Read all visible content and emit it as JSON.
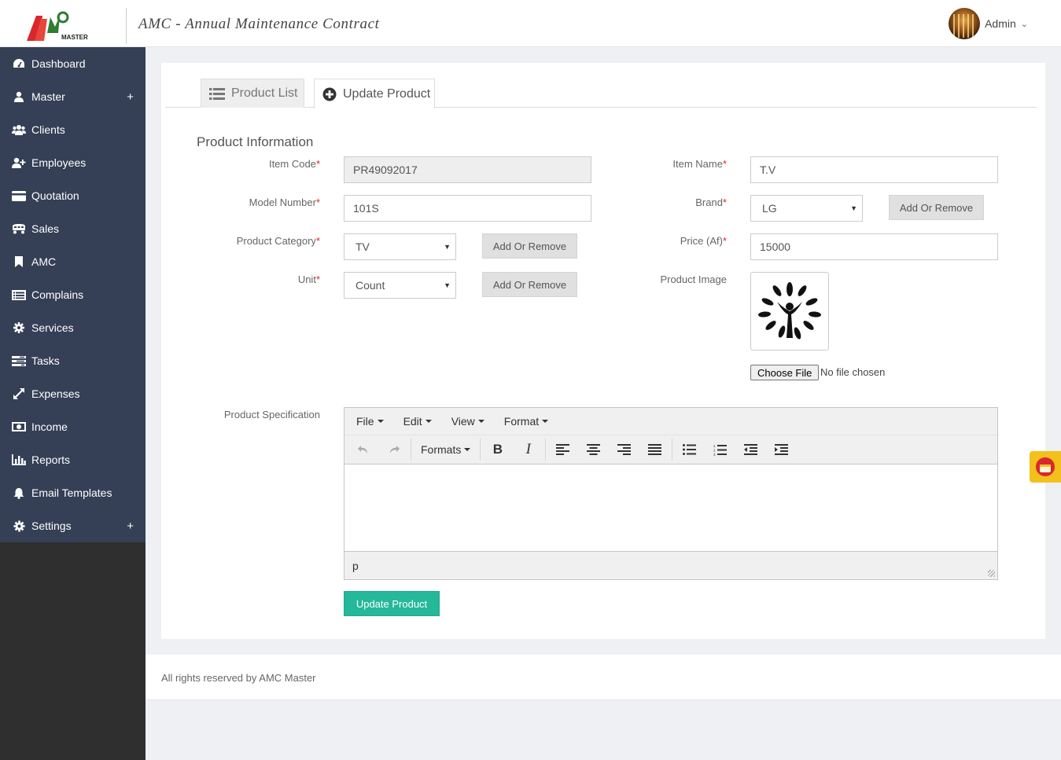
{
  "header": {
    "logo_text": "AMC",
    "logo_subtext": "MASTER",
    "app_title": "AMC - Annual Maintenance Contract",
    "user_name": "Admin"
  },
  "sidebar": {
    "items": [
      {
        "label": "Dashboard",
        "icon": "dashboard-icon"
      },
      {
        "label": "Master",
        "icon": "user-icon",
        "expand": "+"
      },
      {
        "label": "Clients",
        "icon": "users-icon"
      },
      {
        "label": "Employees",
        "icon": "user-plus-icon"
      },
      {
        "label": "Quotation",
        "icon": "credit-card-icon"
      },
      {
        "label": "Sales",
        "icon": "cart-icon"
      },
      {
        "label": "AMC",
        "icon": "bookmark-icon"
      },
      {
        "label": "Complains",
        "icon": "list-icon"
      },
      {
        "label": "Services",
        "icon": "cogs-icon"
      },
      {
        "label": "Tasks",
        "icon": "tasks-icon"
      },
      {
        "label": "Expenses",
        "icon": "expand-icon"
      },
      {
        "label": "Income",
        "icon": "money-icon"
      },
      {
        "label": "Reports",
        "icon": "bar-chart-icon"
      },
      {
        "label": "Email Templates",
        "icon": "bell-icon"
      },
      {
        "label": "Settings",
        "icon": "gear-icon",
        "expand": "+"
      }
    ]
  },
  "tabs": {
    "product_list": "Product List",
    "update_product": "Update Product"
  },
  "form": {
    "section_title": "Product Information",
    "item_code": {
      "label": "Item Code",
      "value": "PR49092017"
    },
    "item_name": {
      "label": "Item Name",
      "value": "T.V"
    },
    "model_number": {
      "label": "Model Number",
      "value": "101S"
    },
    "brand": {
      "label": "Brand",
      "value": "LG"
    },
    "product_category": {
      "label": "Product Category",
      "value": "TV"
    },
    "price": {
      "label": "Price (Af)",
      "value": "15000"
    },
    "unit": {
      "label": "Unit",
      "value": "Count"
    },
    "product_image": {
      "label": "Product Image"
    },
    "add_or_remove": "Add Or Remove",
    "choose_file": "Choose File",
    "no_file": "No file chosen",
    "required_mark": "*",
    "product_specification": "Product Specification",
    "submit": "Update Product"
  },
  "editor": {
    "menus": [
      "File",
      "Edit",
      "View",
      "Format"
    ],
    "formats": "Formats",
    "status_path": "p"
  },
  "footer": {
    "text": "All rights reserved by AMC Master"
  },
  "colors": {
    "sidebar_bg": "#353f55",
    "primary": "#25b89a",
    "required": "#d9272e"
  }
}
